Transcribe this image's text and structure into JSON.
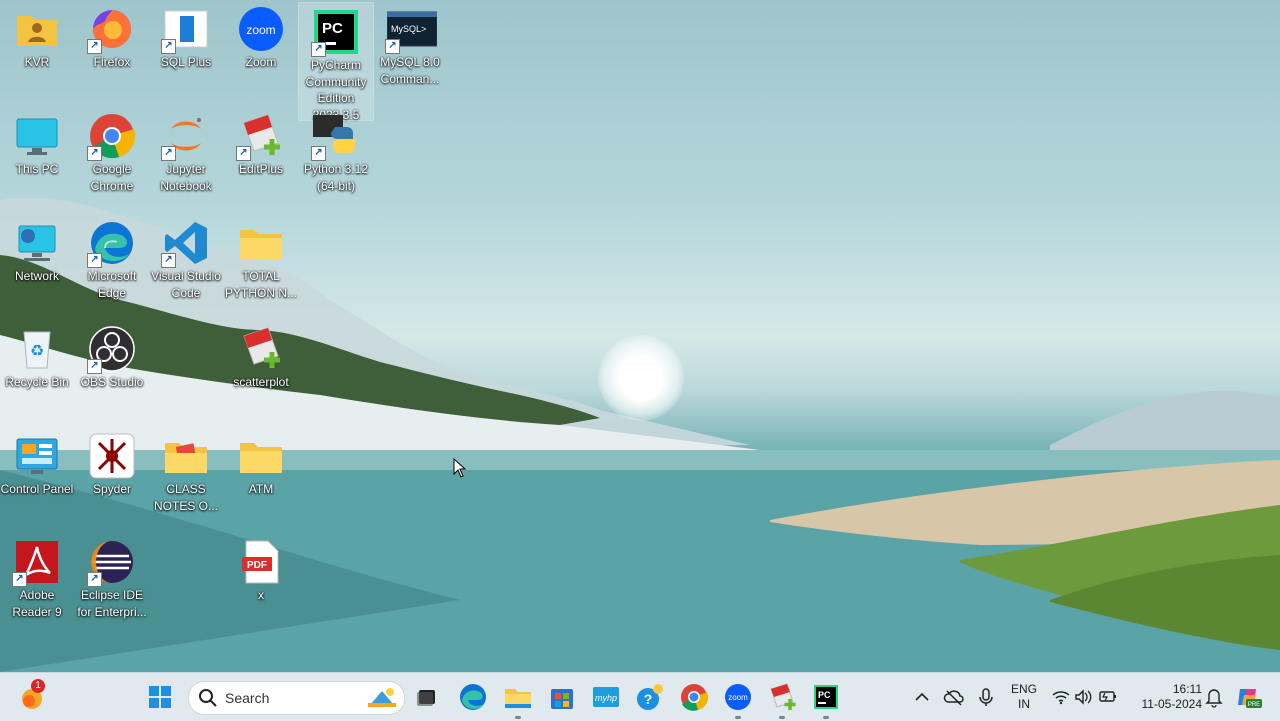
{
  "desktop": {
    "icons": [
      {
        "label": "KVR",
        "icon": "folder-user-icon"
      },
      {
        "label": "Firefox",
        "icon": "firefox-icon"
      },
      {
        "label": "SQL Plus",
        "icon": "sqlplus-icon"
      },
      {
        "label": "Zoom",
        "icon": "zoom-icon",
        "glyph": "zoom"
      },
      {
        "label": "PyCharm Community Edition 2023.3.5",
        "icon": "pycharm-icon",
        "glyph": "PC"
      },
      {
        "label": "MySQL 8.0 Comman...",
        "icon": "mysql-icon",
        "glyph": "MySQL>"
      },
      {
        "label": "This PC",
        "icon": "monitor-icon"
      },
      {
        "label": "Google Chrome",
        "icon": "chrome-icon"
      },
      {
        "label": "Jupyter Notebook",
        "icon": "jupyter-icon"
      },
      {
        "label": "EditPlus",
        "icon": "editplus-icon"
      },
      {
        "label": "Python 3.12 (64-bit)",
        "icon": "python-icon"
      },
      {
        "label": "Network",
        "icon": "network-icon"
      },
      {
        "label": "Microsoft Edge",
        "icon": "edge-icon"
      },
      {
        "label": "Visual Studio Code",
        "icon": "vscode-icon"
      },
      {
        "label": "TOTAL PYTHON N...",
        "icon": "folder-icon"
      },
      {
        "label": "Recycle Bin",
        "icon": "recycle-bin-icon"
      },
      {
        "label": "OBS Studio",
        "icon": "obs-icon"
      },
      {
        "label": "scatterplot",
        "icon": "editplus-icon"
      },
      {
        "label": "Control Panel",
        "icon": "control-panel-icon"
      },
      {
        "label": "Spyder",
        "icon": "spyder-icon"
      },
      {
        "label": "CLASS NOTES O...",
        "icon": "folder-icon"
      },
      {
        "label": "ATM",
        "icon": "folder-icon"
      },
      {
        "label": "Adobe Reader 9",
        "icon": "adobe-reader-icon"
      },
      {
        "label": "Eclipse IDE for Enterpri...",
        "icon": "eclipse-icon"
      },
      {
        "label": "x",
        "icon": "pdf-file-icon",
        "glyph": "PDF"
      }
    ]
  },
  "taskbar": {
    "badge_count": "1",
    "search_placeholder": "Search",
    "apps": [
      "start-icon",
      "task-view-icon",
      "edge-icon",
      "file-explorer-icon",
      "store-icon",
      "myhp-icon",
      "help-icon",
      "chrome-icon",
      "zoom-icon",
      "editplus-icon",
      "pycharm-icon"
    ],
    "myhp_text": "myhp",
    "lang_line1": "ENG",
    "lang_line2": "IN",
    "time": "16:11",
    "date": "11-05-2024"
  },
  "colors": {
    "taskbar_bg": "#dfe9ee",
    "accent": "#0067c0"
  }
}
